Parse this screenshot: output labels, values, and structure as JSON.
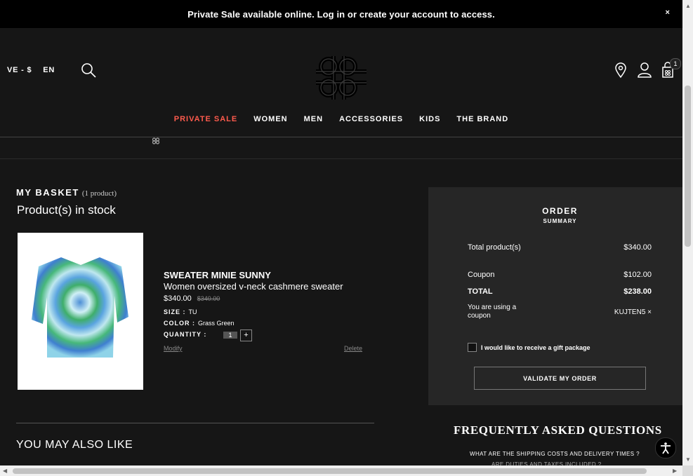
{
  "banner": {
    "text": "Private Sale available online. Log in or create your account to access.",
    "close": "×"
  },
  "header": {
    "locale_region": "VE - $",
    "locale_lang": "EN",
    "cart_count": "1",
    "nav": [
      "PRIVATE SALE",
      "WOMEN",
      "MEN",
      "ACCESSORIES",
      "KIDS",
      "THE BRAND"
    ]
  },
  "basket": {
    "title": "MY BASKET",
    "count": "(1 product)",
    "in_stock": "Product(s) in stock",
    "product": {
      "name": "SWEATER MINIE SUNNY",
      "description": "Women oversized v-neck cashmere sweater",
      "price": "$340.00",
      "old_price": "$340.00",
      "size_label": "SIZE :",
      "size_value": "TU",
      "color_label": "COLOR :",
      "color_value": "Grass Green",
      "quantity_label": "QUANTITY :",
      "quantity_value": "1",
      "quantity_plus": "+",
      "modify": "Modify",
      "delete": "Delete"
    },
    "also_like": "YOU MAY ALSO LIKE"
  },
  "summary": {
    "title": "ORDER",
    "subtitle": "SUMMARY",
    "total_product_label": "Total product(s)",
    "total_product_value": "$340.00",
    "coupon_label": "Coupon",
    "coupon_value": "$102.00",
    "total_label": "TOTAL",
    "total_value": "$238.00",
    "using_coupon_label": "You are using a coupon",
    "coupon_code": "KUJTEN5 ×",
    "gift_label": "I would like to receive a gift package",
    "validate": "VALIDATE MY ORDER"
  },
  "faq": {
    "title": "FREQUENTLY ASKED QUESTIONS",
    "q1": "WHAT ARE THE SHIPPING COSTS AND DELIVERY TIMES ?",
    "q2": "ARE DUTIES AND TAXES INCLUDED ?"
  },
  "colors": {
    "background": "#161616",
    "sale_accent": "#ff5b4d",
    "summary_panel": "#262626"
  }
}
